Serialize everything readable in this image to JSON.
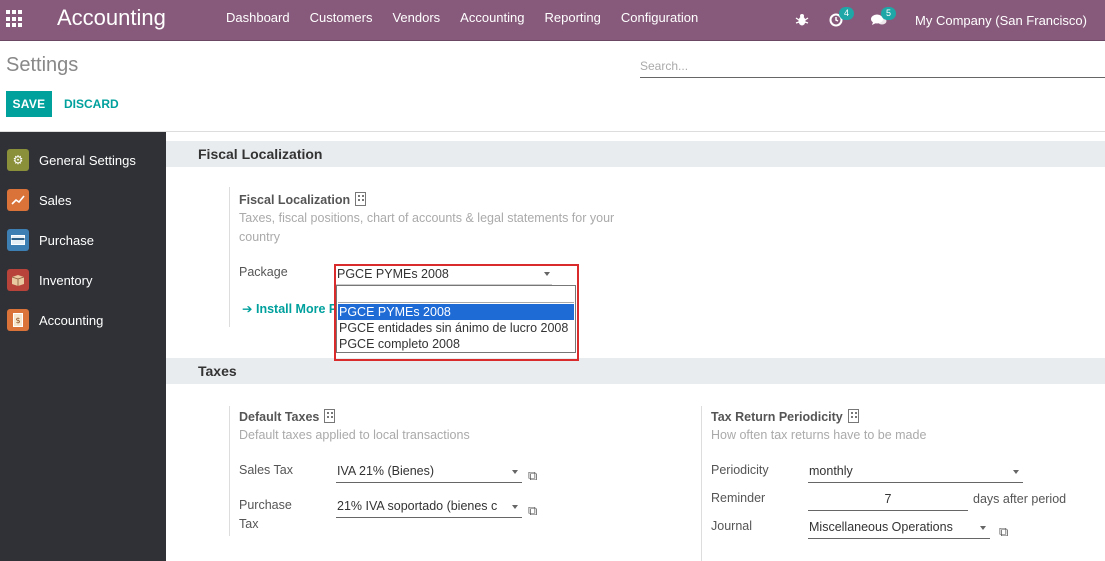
{
  "navbar": {
    "brand": "Accounting",
    "menu": [
      "Dashboard",
      "Customers",
      "Vendors",
      "Accounting",
      "Reporting",
      "Configuration"
    ],
    "activity_count": "4",
    "messages_count": "5",
    "company": "My Company (San Francisco)"
  },
  "control_panel": {
    "title": "Settings",
    "search_placeholder": "Search...",
    "save_label": "SAVE",
    "discard_label": "DISCARD"
  },
  "sidebar": {
    "items": [
      {
        "label": "General Settings",
        "icon": "gear-icon",
        "color": "#8a8f3a"
      },
      {
        "label": "Sales",
        "icon": "chart-icon",
        "color": "#d9733a"
      },
      {
        "label": "Purchase",
        "icon": "card-icon",
        "color": "#3d7fb3"
      },
      {
        "label": "Inventory",
        "icon": "box-icon",
        "color": "#b8433a"
      },
      {
        "label": "Accounting",
        "icon": "invoice-icon",
        "color": "#d9733a"
      }
    ],
    "active": "Accounting"
  },
  "fiscal": {
    "section_title": "Fiscal Localization",
    "field_title": "Fiscal Localization",
    "help_line1": "Taxes, fiscal positions, chart of accounts & legal statements for your",
    "help_line2": "country",
    "package_label": "Package",
    "package_value": "PGCE PYMEs 2008",
    "install_link": "Install More P",
    "options": [
      "PGCE PYMEs 2008",
      "PGCE entidades sin ánimo de lucro 2008",
      "PGCE completo 2008"
    ],
    "selected_option": "PGCE PYMEs 2008"
  },
  "taxes": {
    "section_title": "Taxes",
    "default_taxes": {
      "title": "Default Taxes",
      "help": "Default taxes applied to local transactions",
      "sales_tax_label": "Sales Tax",
      "sales_tax_value": "IVA 21% (Bienes)",
      "purchase_tax_label_1": "Purchase",
      "purchase_tax_label_2": "Tax",
      "purchase_tax_value": "21% IVA soportado (bienes c"
    },
    "periodicity": {
      "title": "Tax Return Periodicity",
      "help": "How often tax returns have to be made",
      "periodicity_label": "Periodicity",
      "periodicity_value": "monthly",
      "reminder_label": "Reminder",
      "reminder_value": "7",
      "reminder_suffix": "days after period",
      "journal_label": "Journal",
      "journal_value": "Miscellaneous Operations"
    }
  },
  "colors": {
    "navbar": "#875a7b",
    "accent": "#00a09d",
    "sidebar": "#2f3136",
    "highlight": "#d92b2b",
    "selected_option": "#1e6bd6"
  }
}
